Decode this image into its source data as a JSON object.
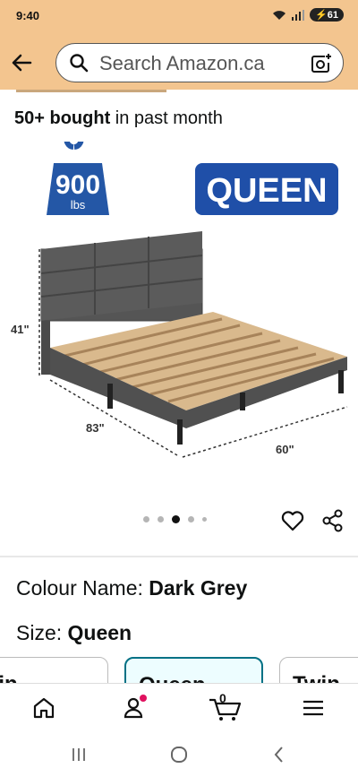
{
  "status_bar": {
    "time": "9:40",
    "battery": "61"
  },
  "header": {
    "search_placeholder": "Search Amazon.ca"
  },
  "social_proof": {
    "count": "50+ bought",
    "suffix": " in past month"
  },
  "product_image": {
    "weight_value": "900",
    "weight_unit": "lbs",
    "size_badge": "QUEEN",
    "height": "41\"",
    "length": "83\"",
    "width": "60\""
  },
  "carousel": {
    "total": 5,
    "active_index": 2
  },
  "variants": {
    "colour_label": "Colour Name: ",
    "colour_value": "Dark Grey",
    "size_label": "Size: ",
    "size_value": "Queen",
    "size_options": [
      "Kin",
      "Queen",
      "Twin"
    ]
  },
  "bottom_nav": {
    "cart_count": "0"
  }
}
